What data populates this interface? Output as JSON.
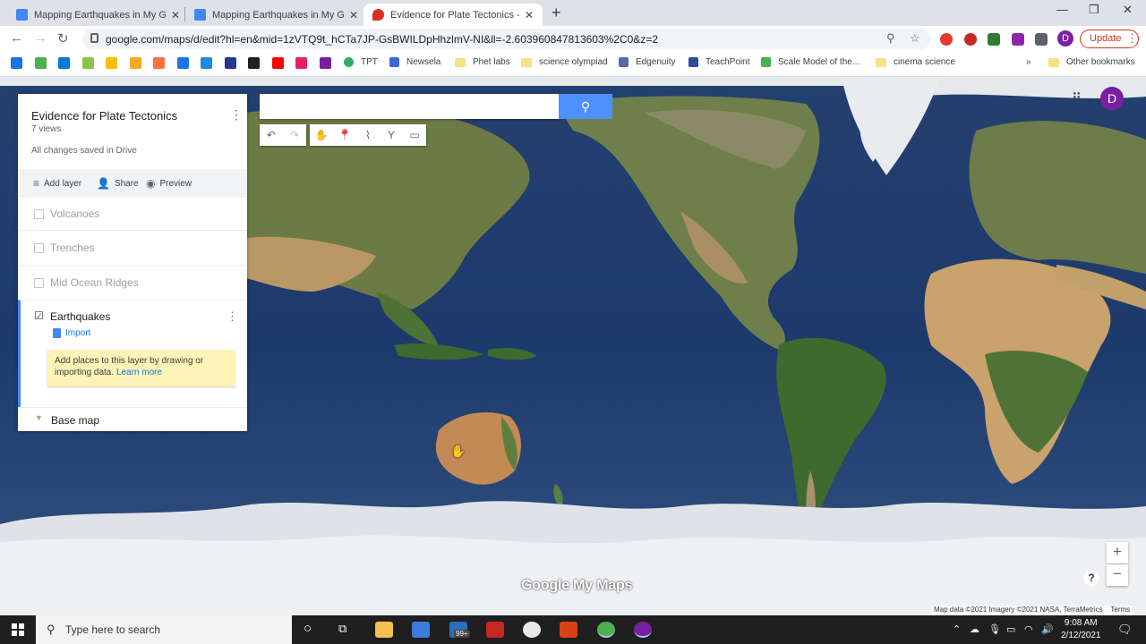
{
  "browser": {
    "tabs": [
      {
        "title": "Mapping Earthquakes in My Goo",
        "favicon_color": "#4285f4"
      },
      {
        "title": "Mapping Earthquakes in My Goo",
        "favicon_color": "#4285f4"
      },
      {
        "title": "Evidence for Plate Tectonics - Go",
        "favicon_color": "#d93025"
      }
    ],
    "close_glyph": "✕",
    "new_tab_glyph": "+",
    "window_controls": {
      "minimize": "—",
      "maximize": "❐",
      "close": "✕"
    },
    "url": "google.com/maps/d/edit?hl=en&mid=1zVTQ9t_hCTa7JP-GsBWILDpHhzlmV-NI&ll=-2.603960847813603%2C0&z=2",
    "update_label": "Update",
    "profile_initial": "D",
    "bookmarks": [
      {
        "label": "TPT",
        "color": "#2fae5a"
      },
      {
        "label": "Newsela",
        "color": "#3f67d1"
      },
      {
        "label": "Phet labs",
        "folder": true
      },
      {
        "label": "science olympiad",
        "folder": true
      },
      {
        "label": "Edgenuity",
        "color": "#5a6aa8"
      },
      {
        "label": "TeachPoint",
        "color": "#2d4c9e"
      },
      {
        "label": "Scale Model of the...",
        "color": "#4caf50"
      },
      {
        "label": "cinema science",
        "folder": true
      }
    ],
    "more_bookmarks": "»",
    "other_bookmarks": "Other bookmarks"
  },
  "map": {
    "title": "Evidence for Plate Tectonics",
    "views": "7 views",
    "saved_status": "All changes saved in Drive",
    "actions": {
      "add_layer": "Add layer",
      "share": "Share",
      "preview": "Preview"
    },
    "layers": [
      {
        "label": "Volcanoes",
        "checked": false
      },
      {
        "label": "Trenches",
        "checked": false
      },
      {
        "label": "Mid Ocean Ridges",
        "checked": false
      }
    ],
    "active_layer": {
      "label": "Earthquakes",
      "checked": true,
      "import_label": "Import",
      "hint_text": "Add places to this layer by drawing or importing data.",
      "hint_link": "Learn more"
    },
    "base_map_label": "Base map",
    "search_placeholder": "",
    "logo_text": "Google My Maps",
    "attribution": "Map data ©2021 Imagery ©2021 NASA, TerraMetrics",
    "terms": "Terms",
    "zoom_in": "+",
    "zoom_out": "−",
    "help": "?",
    "user_initial": "D"
  },
  "taskbar": {
    "search_placeholder": "Type here to search",
    "mail_badge": "99+",
    "time": "9:08 AM",
    "date": "2/12/2021"
  },
  "colors": {
    "accent_blue": "#4d90fe",
    "layer_accent": "#4285f4",
    "hint_bg": "#fdf3b6",
    "profile_purple": "#7b1fa2",
    "update_red": "#d93025"
  }
}
